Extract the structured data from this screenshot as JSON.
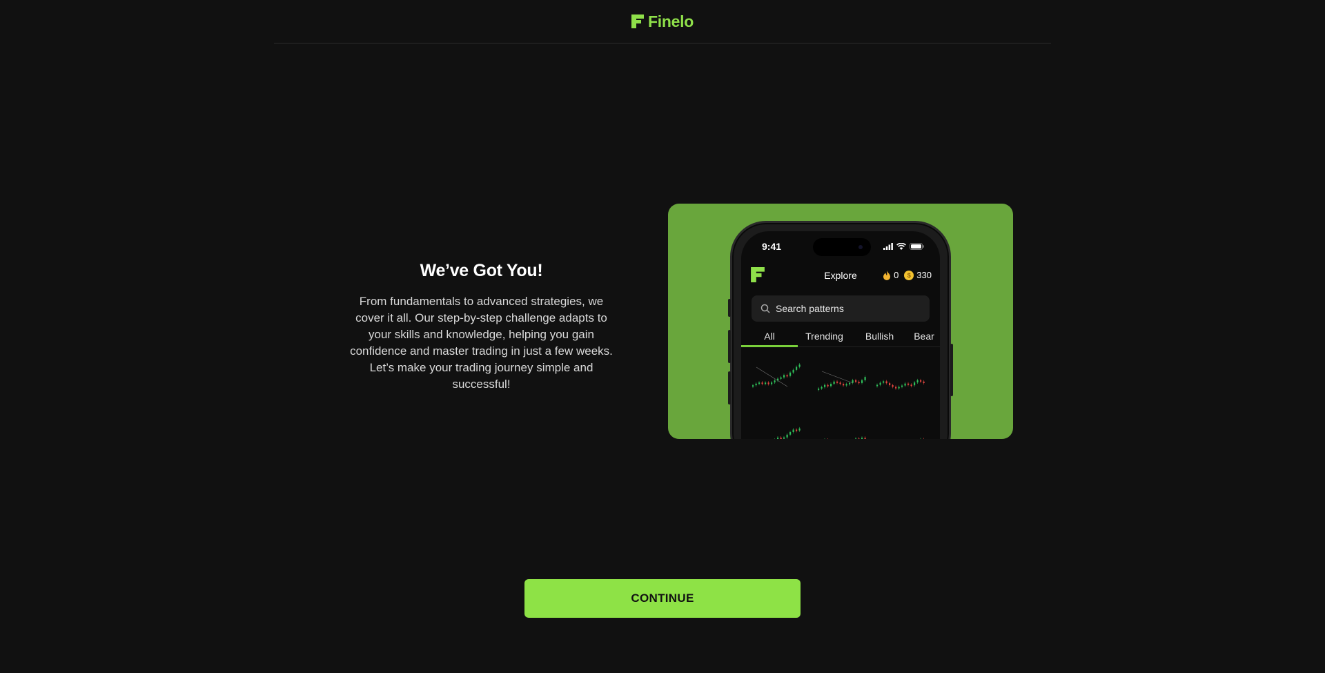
{
  "header": {
    "brand": "Finelo"
  },
  "intro": {
    "title": "We’ve Got You!",
    "body": "From fundamentals to advanced strategies, we cover it all. Our step-by-step challenge adapts to your skills and knowledge, helping you gain confidence and master trading in just a few weeks. Let’s make your trading journey simple and successful!"
  },
  "phone": {
    "time": "9:41",
    "screen_title": "Explore",
    "streak": "0",
    "coins": "330",
    "coin_symbol": "$",
    "search_placeholder": "Search patterns",
    "tabs": [
      "All",
      "Trending",
      "Bullish",
      "Bear"
    ],
    "active_tab": "All"
  },
  "cta": {
    "label": "CONTINUE"
  },
  "colors": {
    "background": "#111111",
    "accent": "#8ee246",
    "promo_bg": "#69a63c",
    "bull": "#2fbf5a",
    "bear": "#e2463f"
  }
}
